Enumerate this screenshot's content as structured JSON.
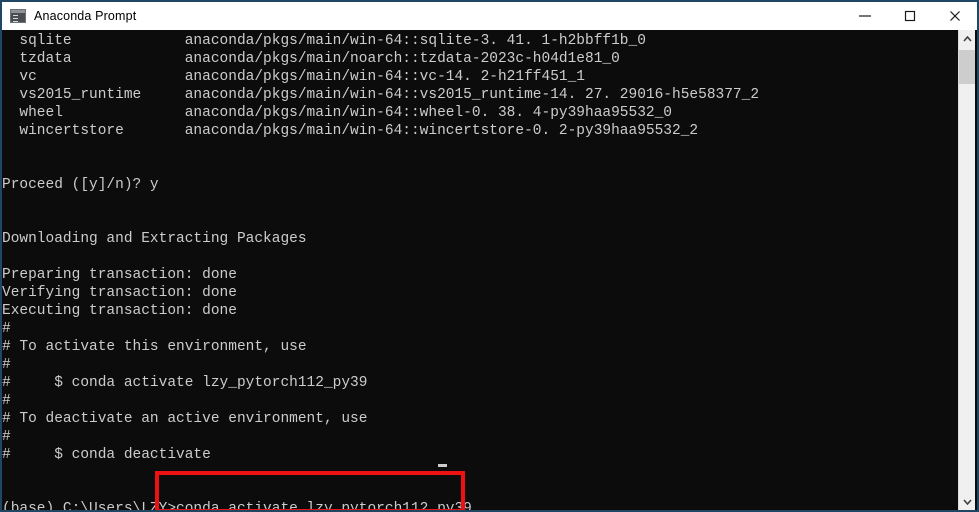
{
  "window": {
    "title": "Anaconda Prompt",
    "icon": "console-icon",
    "border_color": "#1f4662",
    "titlebar_bg": "#ffffff",
    "console_bg": "#0c0c0c",
    "console_fg": "#cccccc",
    "controls": [
      {
        "name": "minimize",
        "label": "—"
      },
      {
        "name": "maximize",
        "label": "□"
      },
      {
        "name": "close",
        "label": "✕"
      }
    ]
  },
  "console": {
    "text": "  sqlite             anaconda/pkgs/main/win-64::sqlite-3. 41. 1-h2bbff1b_0\n  tzdata             anaconda/pkgs/main/noarch::tzdata-2023c-h04d1e81_0\n  vc                 anaconda/pkgs/main/win-64::vc-14. 2-h21ff451_1\n  vs2015_runtime     anaconda/pkgs/main/win-64::vs2015_runtime-14. 27. 29016-h5e58377_2\n  wheel              anaconda/pkgs/main/win-64::wheel-0. 38. 4-py39haa95532_0\n  wincertstore       anaconda/pkgs/main/win-64::wincertstore-0. 2-py39haa95532_2\n\n\nProceed ([y]/n)? y\n\n\nDownloading and Extracting Packages\n\nPreparing transaction: done\nVerifying transaction: done\nExecuting transaction: done\n#\n# To activate this environment, use\n#\n#     $ conda activate lzy_pytorch112_py39\n#\n# To deactivate an active environment, use\n#\n#     $ conda deactivate\n\n\n(base) C:\\Users\\LZY>conda activate lzy_pytorch112_py39",
    "lines": [
      "  sqlite             anaconda/pkgs/main/win-64::sqlite-3. 41. 1-h2bbff1b_0",
      "  tzdata             anaconda/pkgs/main/noarch::tzdata-2023c-h04d1e81_0",
      "  vc                 anaconda/pkgs/main/win-64::vc-14. 2-h21ff451_1",
      "  vs2015_runtime     anaconda/pkgs/main/win-64::vs2015_runtime-14. 27. 29016-h5e58377_2",
      "  wheel              anaconda/pkgs/main/win-64::wheel-0. 38. 4-py39haa95532_0",
      "  wincertstore       anaconda/pkgs/main/win-64::wincertstore-0. 2-py39haa95532_2",
      "",
      "",
      "Proceed ([y]/n)? y",
      "",
      "",
      "Downloading and Extracting Packages",
      "",
      "Preparing transaction: done",
      "Verifying transaction: done",
      "Executing transaction: done",
      "#",
      "# To activate this environment, use",
      "#",
      "#     $ conda activate lzy_pytorch112_py39",
      "#",
      "# To deactivate an active environment, use",
      "#",
      "#     $ conda deactivate",
      "",
      "",
      "(base) C:\\Users\\LZY>conda activate lzy_pytorch112_py39"
    ],
    "packages": [
      {
        "name": "sqlite",
        "spec": "anaconda/pkgs/main/win-64::sqlite-3. 41. 1-h2bbff1b_0"
      },
      {
        "name": "tzdata",
        "spec": "anaconda/pkgs/main/noarch::tzdata-2023c-h04d1e81_0"
      },
      {
        "name": "vc",
        "spec": "anaconda/pkgs/main/win-64::vc-14. 2-h21ff451_1"
      },
      {
        "name": "vs2015_runtime",
        "spec": "anaconda/pkgs/main/win-64::vs2015_runtime-14. 27. 29016-h5e58377_2"
      },
      {
        "name": "wheel",
        "spec": "anaconda/pkgs/main/win-64::wheel-0. 38. 4-py39haa95532_0"
      },
      {
        "name": "wincertstore",
        "spec": "anaconda/pkgs/main/win-64::wincertstore-0. 2-py39haa95532_2"
      }
    ],
    "proceed_prompt": "Proceed ([y]/n)? y",
    "status_messages": [
      "Downloading and Extracting Packages",
      "Preparing transaction: done",
      "Verifying transaction: done",
      "Executing transaction: done"
    ],
    "activate_hint": "# To activate this environment, use",
    "activate_command": "#     $ conda activate lzy_pytorch112_py39",
    "deactivate_hint": "# To deactivate an active environment, use",
    "deactivate_command": "#     $ conda deactivate",
    "prompt_prefix": "(base) C:\\Users\\LZY>",
    "current_command": "conda activate lzy_pytorch112_py39",
    "environment_name": "lzy_pytorch112_py39"
  },
  "annotation": {
    "color": "#ee1111",
    "target": "conda activate lzy_pytorch112_py39"
  },
  "scrollbar": {
    "up_arrow": "⌃",
    "down_arrow": "⌄",
    "thumb_position": "near-top"
  }
}
